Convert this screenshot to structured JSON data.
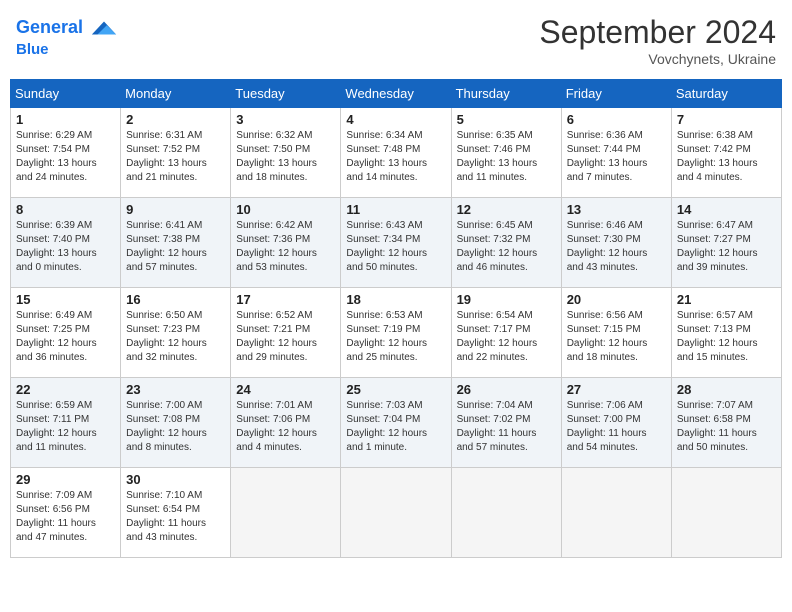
{
  "header": {
    "logo_line1": "General",
    "logo_line2": "Blue",
    "month": "September 2024",
    "location": "Vovchynets, Ukraine"
  },
  "days_of_week": [
    "Sunday",
    "Monday",
    "Tuesday",
    "Wednesday",
    "Thursday",
    "Friday",
    "Saturday"
  ],
  "weeks": [
    [
      {
        "day": "1",
        "info": "Sunrise: 6:29 AM\nSunset: 7:54 PM\nDaylight: 13 hours\nand 24 minutes."
      },
      {
        "day": "2",
        "info": "Sunrise: 6:31 AM\nSunset: 7:52 PM\nDaylight: 13 hours\nand 21 minutes."
      },
      {
        "day": "3",
        "info": "Sunrise: 6:32 AM\nSunset: 7:50 PM\nDaylight: 13 hours\nand 18 minutes."
      },
      {
        "day": "4",
        "info": "Sunrise: 6:34 AM\nSunset: 7:48 PM\nDaylight: 13 hours\nand 14 minutes."
      },
      {
        "day": "5",
        "info": "Sunrise: 6:35 AM\nSunset: 7:46 PM\nDaylight: 13 hours\nand 11 minutes."
      },
      {
        "day": "6",
        "info": "Sunrise: 6:36 AM\nSunset: 7:44 PM\nDaylight: 13 hours\nand 7 minutes."
      },
      {
        "day": "7",
        "info": "Sunrise: 6:38 AM\nSunset: 7:42 PM\nDaylight: 13 hours\nand 4 minutes."
      }
    ],
    [
      {
        "day": "8",
        "info": "Sunrise: 6:39 AM\nSunset: 7:40 PM\nDaylight: 13 hours\nand 0 minutes."
      },
      {
        "day": "9",
        "info": "Sunrise: 6:41 AM\nSunset: 7:38 PM\nDaylight: 12 hours\nand 57 minutes."
      },
      {
        "day": "10",
        "info": "Sunrise: 6:42 AM\nSunset: 7:36 PM\nDaylight: 12 hours\nand 53 minutes."
      },
      {
        "day": "11",
        "info": "Sunrise: 6:43 AM\nSunset: 7:34 PM\nDaylight: 12 hours\nand 50 minutes."
      },
      {
        "day": "12",
        "info": "Sunrise: 6:45 AM\nSunset: 7:32 PM\nDaylight: 12 hours\nand 46 minutes."
      },
      {
        "day": "13",
        "info": "Sunrise: 6:46 AM\nSunset: 7:30 PM\nDaylight: 12 hours\nand 43 minutes."
      },
      {
        "day": "14",
        "info": "Sunrise: 6:47 AM\nSunset: 7:27 PM\nDaylight: 12 hours\nand 39 minutes."
      }
    ],
    [
      {
        "day": "15",
        "info": "Sunrise: 6:49 AM\nSunset: 7:25 PM\nDaylight: 12 hours\nand 36 minutes."
      },
      {
        "day": "16",
        "info": "Sunrise: 6:50 AM\nSunset: 7:23 PM\nDaylight: 12 hours\nand 32 minutes."
      },
      {
        "day": "17",
        "info": "Sunrise: 6:52 AM\nSunset: 7:21 PM\nDaylight: 12 hours\nand 29 minutes."
      },
      {
        "day": "18",
        "info": "Sunrise: 6:53 AM\nSunset: 7:19 PM\nDaylight: 12 hours\nand 25 minutes."
      },
      {
        "day": "19",
        "info": "Sunrise: 6:54 AM\nSunset: 7:17 PM\nDaylight: 12 hours\nand 22 minutes."
      },
      {
        "day": "20",
        "info": "Sunrise: 6:56 AM\nSunset: 7:15 PM\nDaylight: 12 hours\nand 18 minutes."
      },
      {
        "day": "21",
        "info": "Sunrise: 6:57 AM\nSunset: 7:13 PM\nDaylight: 12 hours\nand 15 minutes."
      }
    ],
    [
      {
        "day": "22",
        "info": "Sunrise: 6:59 AM\nSunset: 7:11 PM\nDaylight: 12 hours\nand 11 minutes."
      },
      {
        "day": "23",
        "info": "Sunrise: 7:00 AM\nSunset: 7:08 PM\nDaylight: 12 hours\nand 8 minutes."
      },
      {
        "day": "24",
        "info": "Sunrise: 7:01 AM\nSunset: 7:06 PM\nDaylight: 12 hours\nand 4 minutes."
      },
      {
        "day": "25",
        "info": "Sunrise: 7:03 AM\nSunset: 7:04 PM\nDaylight: 12 hours\nand 1 minute."
      },
      {
        "day": "26",
        "info": "Sunrise: 7:04 AM\nSunset: 7:02 PM\nDaylight: 11 hours\nand 57 minutes."
      },
      {
        "day": "27",
        "info": "Sunrise: 7:06 AM\nSunset: 7:00 PM\nDaylight: 11 hours\nand 54 minutes."
      },
      {
        "day": "28",
        "info": "Sunrise: 7:07 AM\nSunset: 6:58 PM\nDaylight: 11 hours\nand 50 minutes."
      }
    ],
    [
      {
        "day": "29",
        "info": "Sunrise: 7:09 AM\nSunset: 6:56 PM\nDaylight: 11 hours\nand 47 minutes."
      },
      {
        "day": "30",
        "info": "Sunrise: 7:10 AM\nSunset: 6:54 PM\nDaylight: 11 hours\nand 43 minutes."
      },
      {
        "day": "",
        "info": ""
      },
      {
        "day": "",
        "info": ""
      },
      {
        "day": "",
        "info": ""
      },
      {
        "day": "",
        "info": ""
      },
      {
        "day": "",
        "info": ""
      }
    ]
  ]
}
